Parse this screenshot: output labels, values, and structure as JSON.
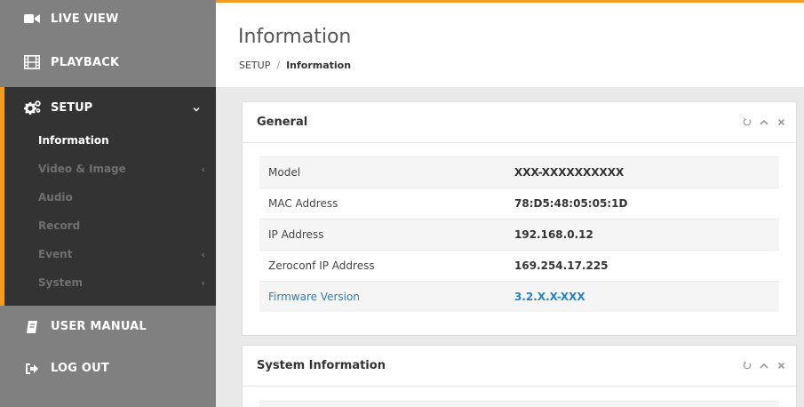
{
  "sidebar": {
    "live_view": "LIVE VIEW",
    "playback": "PLAYBACK",
    "setup": "SETUP",
    "setup_items": [
      {
        "label": "Information",
        "active": true,
        "has_arrow": false
      },
      {
        "label": "Video & Image",
        "active": false,
        "has_arrow": true
      },
      {
        "label": "Audio",
        "active": false,
        "has_arrow": false
      },
      {
        "label": "Record",
        "active": false,
        "has_arrow": false
      },
      {
        "label": "Event",
        "active": false,
        "has_arrow": true
      },
      {
        "label": "System",
        "active": false,
        "has_arrow": true
      }
    ],
    "user_manual": "USER MANUAL",
    "log_out": "LOG OUT"
  },
  "header": {
    "title": "Information",
    "breadcrumb_root": "SETUP",
    "breadcrumb_sep": "/",
    "breadcrumb_current": "Information"
  },
  "general": {
    "title": "General",
    "rows": [
      {
        "label": "Model",
        "value": "XXX-XXXXXXXXXX"
      },
      {
        "label": "MAC Address",
        "value": "78:D5:48:05:05:1D"
      },
      {
        "label": "IP Address",
        "value": "192.168.0.12"
      },
      {
        "label": "Zeroconf IP Address",
        "value": "169.254.17.225"
      },
      {
        "label": "Firmware Version",
        "value": "3.2.X.X-XXX"
      }
    ]
  },
  "system_info": {
    "title": "System Information"
  },
  "colors": {
    "accent": "#f39c1e",
    "link": "#2a7fbf",
    "sidebar_bg": "#808080",
    "submenu_bg": "#333333"
  },
  "icons": {
    "live_view": "video-camera-icon",
    "playback": "film-icon",
    "setup": "gears-icon",
    "user_manual": "book-icon",
    "log_out": "sign-out-icon",
    "panel_tools": [
      "refresh-icon",
      "collapse-icon",
      "close-icon"
    ]
  }
}
